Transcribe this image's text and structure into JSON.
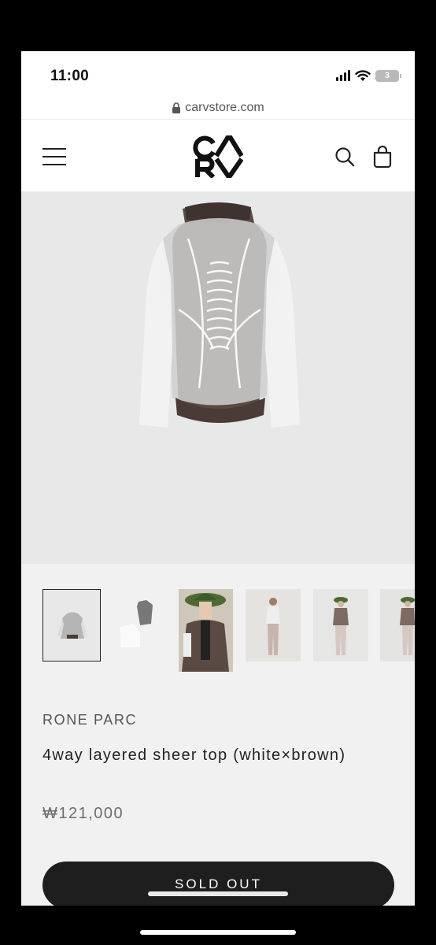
{
  "status_bar": {
    "time": "11:00",
    "battery": "3"
  },
  "browser": {
    "url": "carvstore.com"
  },
  "header": {
    "logo_text": "CARV",
    "menu_icon": "hamburger-menu-icon",
    "search_icon": "search-icon",
    "cart_icon": "shopping-bag-icon"
  },
  "gallery": {
    "thumbnail_count": 6,
    "active_index": 0
  },
  "product": {
    "brand": "RONE PARC",
    "title": "4way layered sheer top (white×brown)",
    "price": "₩121,000",
    "button_label": "SOLD OUT"
  },
  "colors": {
    "page_bg": "#f1f1f1",
    "button_bg": "#1e1e1e",
    "image_bg": "#e8e8e8"
  }
}
